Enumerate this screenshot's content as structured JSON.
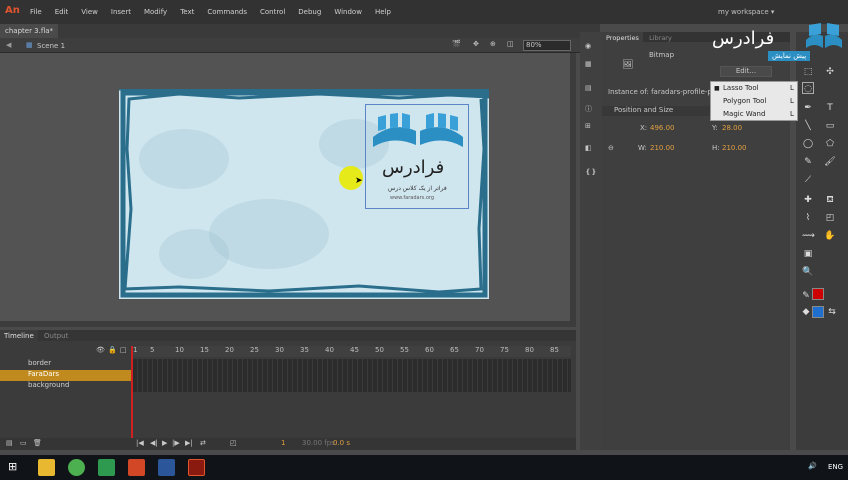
{
  "app": {
    "logo": "An",
    "menus": [
      "File",
      "Edit",
      "View",
      "Insert",
      "Modify",
      "Text",
      "Commands",
      "Control",
      "Debug",
      "Window",
      "Help"
    ],
    "workspace": "my workspace ▾"
  },
  "doc": {
    "tab": "chapter 3.fla*",
    "scene": "Scene 1",
    "zoom": "80%"
  },
  "stage_logo": {
    "title": "فرادرس",
    "tagline": "فراتر از یک کلاس درس",
    "url": "www.faradars.org"
  },
  "timeline": {
    "tabs": [
      "Timeline",
      "Output"
    ],
    "layers": [
      "border",
      "FaraDars",
      "background"
    ],
    "ruler": [
      "1",
      "5",
      "10",
      "15",
      "20",
      "25",
      "30",
      "35",
      "40",
      "45",
      "50",
      "55",
      "60",
      "65",
      "70",
      "75",
      "80",
      "85"
    ],
    "fps": "30.00 fps",
    "time": "0.0 s",
    "frame": "1"
  },
  "props": {
    "tabs": [
      "Properties",
      "Library"
    ],
    "type": "Bitmap",
    "edit": "Edit...",
    "instance": "Instance of: faradars-profile-pi",
    "section": "Position and Size",
    "x_label": "X:",
    "x": "496.00",
    "y_label": "Y:",
    "y": "28.00",
    "w_label": "W:",
    "w": "210.00",
    "h_label": "H:",
    "h": "210.00"
  },
  "flyout": {
    "items": [
      {
        "label": "Lasso Tool",
        "key": "L"
      },
      {
        "label": "Polygon Tool",
        "key": "L"
      },
      {
        "label": "Magic Wand",
        "key": "L"
      }
    ]
  },
  "brand": {
    "name": "فرادرس",
    "sub": "پیش نمایش"
  },
  "taskbar": {
    "lang": "ENG"
  },
  "colors": {
    "accent": "#e0542e",
    "stroke": "#cc0000",
    "fill": "#1e6fd0",
    "frame": "#2a6e8c"
  }
}
